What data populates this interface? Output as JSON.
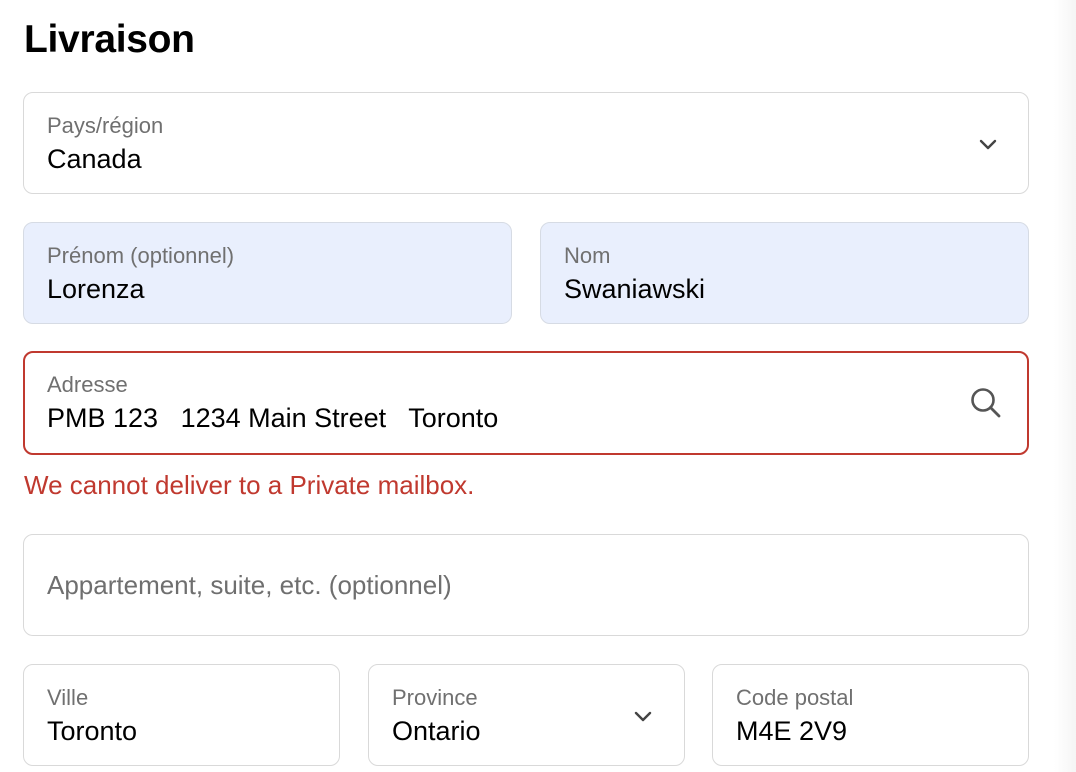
{
  "section": {
    "title": "Livraison"
  },
  "country": {
    "label": "Pays/région",
    "value": "Canada",
    "icon": "chevron-down-icon"
  },
  "first_name": {
    "label": "Prénom (optionnel)",
    "value": "Lorenza"
  },
  "last_name": {
    "label": "Nom",
    "value": "Swaniawski"
  },
  "address": {
    "label": "Adresse",
    "value": "PMB 123   1234 Main Street   Toronto",
    "icon": "search-icon",
    "error": "We cannot deliver to a Private mailbox."
  },
  "apartment": {
    "placeholder": "Appartement, suite, etc. (optionnel)"
  },
  "city": {
    "label": "Ville",
    "value": "Toronto"
  },
  "province": {
    "label": "Province",
    "value": "Ontario",
    "icon": "chevron-down-icon"
  },
  "postal_code": {
    "label": "Code postal",
    "value": "M4E 2V9"
  },
  "colors": {
    "error": "#c0392f",
    "autofill_background": "#e9effd",
    "border": "#d9d9d9",
    "label": "#707070"
  }
}
